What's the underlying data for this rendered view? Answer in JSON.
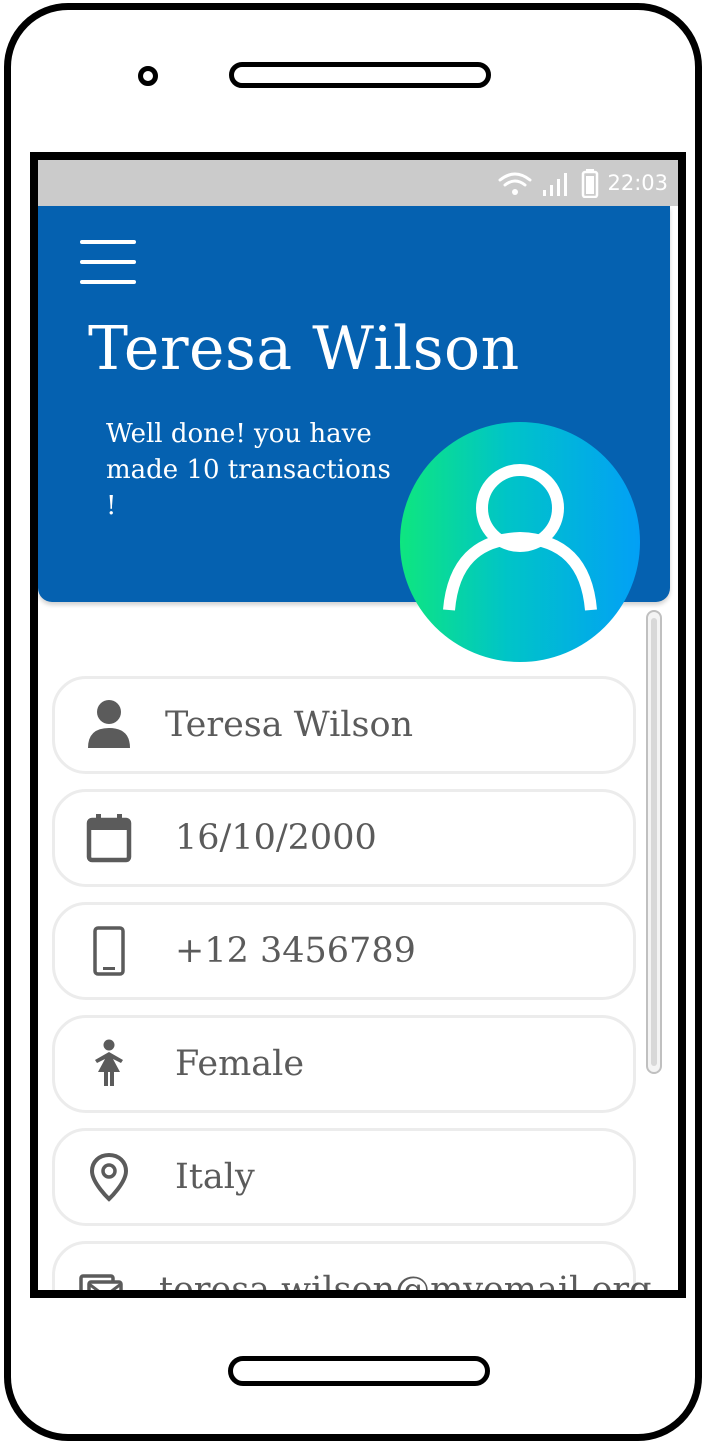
{
  "status_bar": {
    "time": "22:03"
  },
  "header": {
    "title": "Teresa Wilson",
    "subtitle": "Well done! you have made 10 transactions !"
  },
  "fields": [
    {
      "icon": "person-icon",
      "value": "Teresa Wilson"
    },
    {
      "icon": "calendar-icon",
      "value": "16/10/2000"
    },
    {
      "icon": "phone-icon",
      "value": "+12 3456789"
    },
    {
      "icon": "female-icon",
      "value": "Female"
    },
    {
      "icon": "location-pin-icon",
      "value": "Italy"
    },
    {
      "icon": "mail-icon",
      "value": "teresa.wilson@myemail.org"
    }
  ],
  "colors": {
    "header_bg": "#0561b0",
    "status_bar_bg": "#cbcbcb",
    "avatar_gradient": [
      "#0ee67f",
      "#00c4c8",
      "#02a0f6"
    ],
    "field_text": "#5b5b5b",
    "icon_color": "#5b5b5b"
  }
}
